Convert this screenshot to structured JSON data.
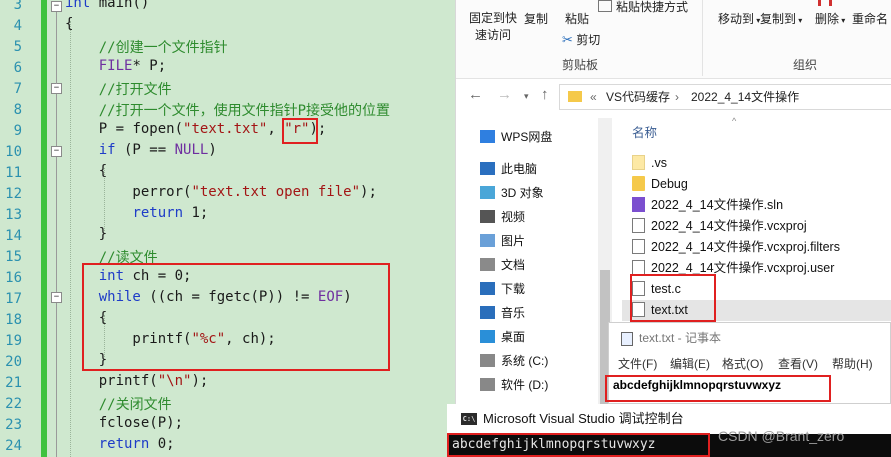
{
  "editor": {
    "line_numbers": [
      "3",
      "4",
      "5",
      "6",
      "7",
      "8",
      "9",
      "10",
      "11",
      "12",
      "13",
      "14",
      "15",
      "16",
      "17",
      "18",
      "19",
      "20",
      "21",
      "22",
      "23",
      "24"
    ],
    "lines": [
      [
        {
          "t": "int",
          "c": "kw"
        },
        {
          "t": " main()",
          "c": ""
        }
      ],
      [
        {
          "t": "{",
          "c": ""
        }
      ],
      [
        {
          "t": "    //创建一个文件指针",
          "c": "cm"
        }
      ],
      [
        {
          "t": "    ",
          "c": ""
        },
        {
          "t": "FILE",
          "c": "mac"
        },
        {
          "t": "* P;",
          "c": ""
        }
      ],
      [
        {
          "t": "    //打开文件",
          "c": "cm"
        }
      ],
      [
        {
          "t": "    //打开一个文件，使用文件指针P接受他的位置",
          "c": "cm"
        }
      ],
      [
        {
          "t": "    P = ",
          "c": ""
        },
        {
          "t": "fopen",
          "c": ""
        },
        {
          "t": "(",
          "c": ""
        },
        {
          "t": "\"text.txt\"",
          "c": "str"
        },
        {
          "t": ", ",
          "c": ""
        },
        {
          "t": "\"r\"",
          "c": "str"
        },
        {
          "t": ");",
          "c": ""
        }
      ],
      [
        {
          "t": "    ",
          "c": ""
        },
        {
          "t": "if",
          "c": "kw"
        },
        {
          "t": " (P == ",
          "c": ""
        },
        {
          "t": "NULL",
          "c": "mac"
        },
        {
          "t": ")",
          "c": ""
        }
      ],
      [
        {
          "t": "    {",
          "c": ""
        }
      ],
      [
        {
          "t": "        perror(",
          "c": ""
        },
        {
          "t": "\"text.txt open file\"",
          "c": "str"
        },
        {
          "t": ");",
          "c": ""
        }
      ],
      [
        {
          "t": "        ",
          "c": ""
        },
        {
          "t": "return",
          "c": "kw"
        },
        {
          "t": " 1;",
          "c": ""
        }
      ],
      [
        {
          "t": "    }",
          "c": ""
        }
      ],
      [
        {
          "t": "    //读文件",
          "c": "cm"
        }
      ],
      [
        {
          "t": "    ",
          "c": ""
        },
        {
          "t": "int",
          "c": "kw"
        },
        {
          "t": " ch = 0;",
          "c": ""
        }
      ],
      [
        {
          "t": "    ",
          "c": ""
        },
        {
          "t": "while",
          "c": "kw"
        },
        {
          "t": " ((ch = fgetc(P)) != ",
          "c": ""
        },
        {
          "t": "EOF",
          "c": "mac"
        },
        {
          "t": ")",
          "c": ""
        }
      ],
      [
        {
          "t": "    {",
          "c": ""
        }
      ],
      [
        {
          "t": "        printf(",
          "c": ""
        },
        {
          "t": "\"%c\"",
          "c": "str"
        },
        {
          "t": ", ch);",
          "c": ""
        }
      ],
      [
        {
          "t": "    }",
          "c": ""
        }
      ],
      [
        {
          "t": "    printf(",
          "c": ""
        },
        {
          "t": "\"\\n\"",
          "c": "str"
        },
        {
          "t": ");",
          "c": ""
        }
      ],
      [
        {
          "t": "    //关闭文件",
          "c": "cm"
        }
      ],
      [
        {
          "t": "    fclose(P);",
          "c": ""
        }
      ],
      [
        {
          "t": "    ",
          "c": ""
        },
        {
          "t": "return",
          "c": "kw"
        },
        {
          "t": " 0;",
          "c": ""
        }
      ]
    ]
  },
  "ribbon": {
    "pin_quick_access": "固定到快\n速访问",
    "copy": "复制",
    "paste": "粘贴",
    "paste_shortcut": "粘贴快捷方式",
    "cut": "剪切",
    "clipboard_group": "剪贴板",
    "move_to": "移动到",
    "copy_to": "复制到",
    "delete": "删除",
    "rename": "重命名",
    "organize_group": "组织"
  },
  "address": {
    "crumbs_prefix": "«",
    "crumb1": "VS代码缓存",
    "sep": "›",
    "crumb2": "2022_4_14文件操作"
  },
  "nav": {
    "items": [
      "WPS网盘",
      "此电脑",
      "3D 对象",
      "视频",
      "图片",
      "文档",
      "下载",
      "音乐",
      "桌面",
      "系统 (C:)",
      "软件 (D:)"
    ]
  },
  "files": {
    "column_name": "名称",
    "items": [
      ".vs",
      "Debug",
      "2022_4_14文件操作.sln",
      "2022_4_14文件操作.vcxproj",
      "2022_4_14文件操作.vcxproj.filters",
      "2022_4_14文件操作.vcxproj.user",
      "test.c",
      "text.txt"
    ]
  },
  "notepad": {
    "title": "text.txt - 记事本",
    "menu": [
      "文件(F)",
      "编辑(E)",
      "格式(O)",
      "查看(V)",
      "帮助(H)"
    ],
    "content": "abcdefghijklmnopqrstuvwxyz"
  },
  "console": {
    "title": "Microsoft Visual Studio 调试控制台",
    "icon_text": "C:\\",
    "output": "abcdefghijklmnopqrstuvwxyz"
  },
  "watermark": "CSDN @Brant_zero"
}
